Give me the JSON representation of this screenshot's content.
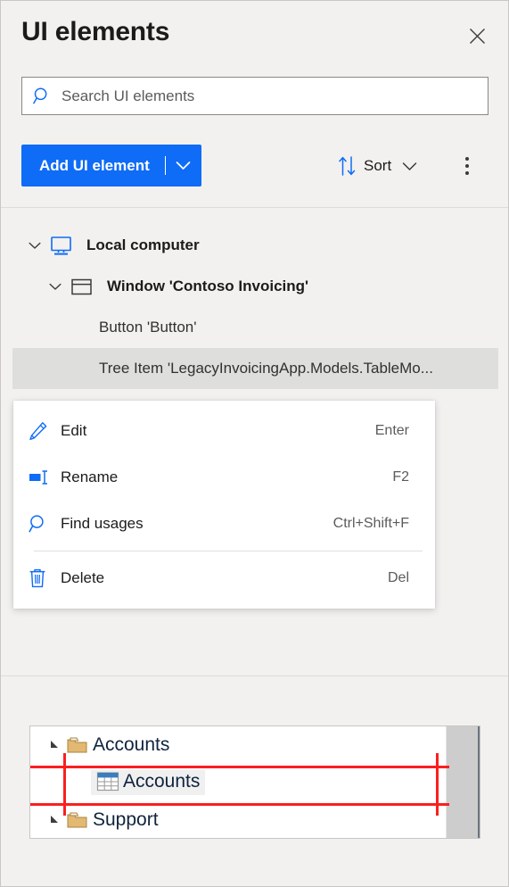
{
  "panel": {
    "title": "UI elements",
    "close_icon": "close-icon"
  },
  "search": {
    "placeholder": "Search UI elements",
    "value": "",
    "icon": "search-icon"
  },
  "toolbar": {
    "add_button_label": "Add UI element",
    "add_button_caret_icon": "chevron-down-icon",
    "add_button_color": "#0f6cf6",
    "sort_label": "Sort",
    "sort_icon": "sort-arrows-icon",
    "sort_caret_icon": "chevron-down-icon",
    "more_icon": "kebab-menu-icon"
  },
  "tree": {
    "items": [
      {
        "label": "Local computer",
        "icon": "monitor-icon",
        "expander": "chevron-down-icon",
        "level": 0,
        "selected": false
      },
      {
        "label": "Window 'Contoso Invoicing'",
        "icon": "window-icon",
        "expander": "chevron-down-icon",
        "level": 1,
        "selected": false
      },
      {
        "label": "Button 'Button'",
        "icon": "",
        "expander": "",
        "level": 2,
        "selected": false
      },
      {
        "label": "Tree Item 'LegacyInvoicingApp.Models.TableMo...",
        "icon": "",
        "expander": "",
        "level": 2,
        "selected": true
      }
    ]
  },
  "context_menu": {
    "items": [
      {
        "label": "Edit",
        "shortcut": "Enter",
        "icon": "pencil-icon"
      },
      {
        "label": "Rename",
        "shortcut": "F2",
        "icon": "rename-icon"
      },
      {
        "label": "Find usages",
        "shortcut": "Ctrl+Shift+F",
        "icon": "search-icon"
      },
      {
        "label": "Delete",
        "shortcut": "Del",
        "icon": "trash-icon"
      }
    ],
    "separator_before_index": 3
  },
  "preview": {
    "rows": [
      {
        "label": "Accounts",
        "icon": "folder-icon",
        "arrow": "triangle-expand-icon",
        "level": 0,
        "highlighted": false
      },
      {
        "label": "Accounts",
        "icon": "table-icon",
        "arrow": "",
        "level": 1,
        "highlighted": true
      },
      {
        "label": "Support",
        "icon": "folder-icon",
        "arrow": "triangle-expand-icon",
        "level": 0,
        "highlighted": false
      }
    ],
    "highlight_color": "#fa1f1f"
  }
}
